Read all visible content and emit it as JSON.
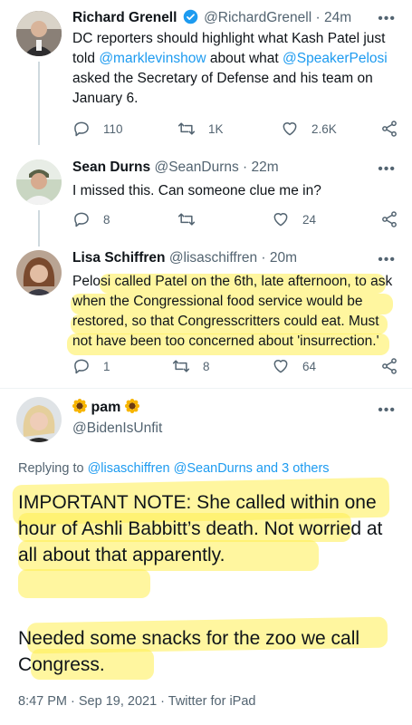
{
  "tweets": [
    {
      "name": "Richard Grenell",
      "handle": "@RichardGrenell",
      "time": "· 24m",
      "verified": true,
      "text_parts": [
        "DC reporters should highlight what Kash Patel just told ",
        "@marklevinshow",
        " about what ",
        "@SpeakerPelosi",
        " asked the Secretary of Defense and his team on January 6."
      ],
      "replies": "110",
      "retweets": "1K",
      "likes": "2.6K"
    },
    {
      "name": "Sean Durns",
      "handle": "@SeanDurns",
      "time": "· 22m",
      "text": "I missed this. Can someone clue me in?",
      "replies": "8",
      "retweets": "",
      "likes": "24"
    },
    {
      "name": "Lisa Schiffren",
      "handle": "@lisaschiffren",
      "time": "· 20m",
      "text": "Pelosi called Patel on the 6th, late afternoon, to ask when the Congressional food service would be restored, so that Congresscritters could eat. Must not have been too concerned about 'insurrection.'",
      "replies": "1",
      "retweets": "8",
      "likes": "64"
    }
  ],
  "main_tweet": {
    "name": "pam",
    "name_emoji": "sunflower",
    "handle": "@BidenIsUnfit",
    "replying_prefix": "Replying to",
    "replying_to": "@lisaschiffren @SeanDurns and 3 others",
    "paragraph1": "IMPORTANT NOTE: She called within one hour of Ashli Babbitt’s death. Not worried at all about that apparently.",
    "paragraph2": "Needed some snacks for the zoo we call Congress.",
    "footer": "8:47 PM · Sep 19, 2021 · Twitter for iPad"
  },
  "colors": {
    "link": "#1d9bf0",
    "muted": "#536471",
    "highlight": "#ffee50"
  }
}
